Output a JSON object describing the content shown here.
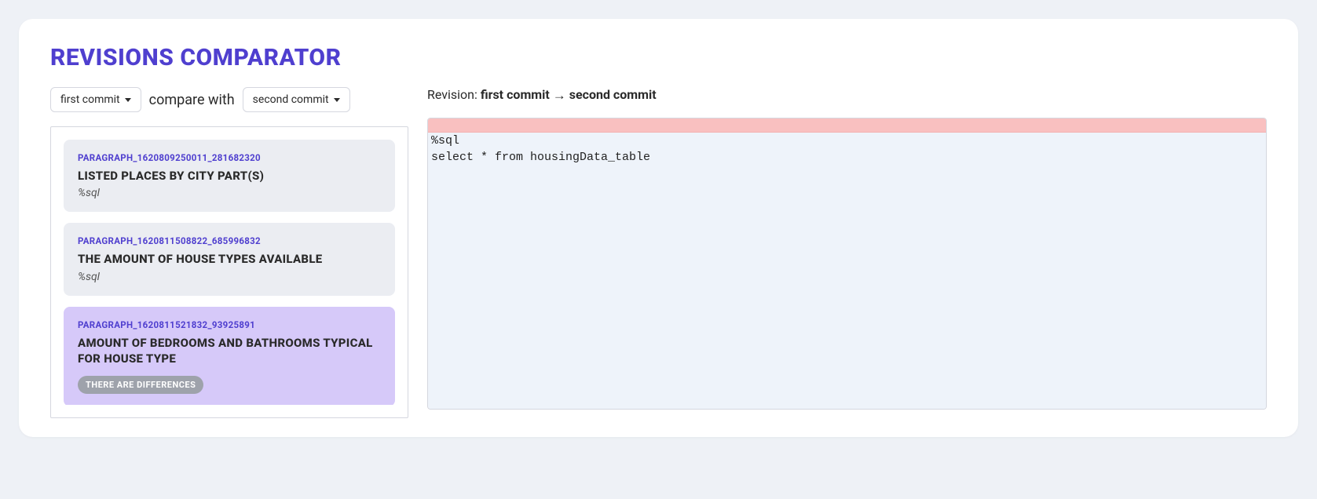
{
  "title": "REVISIONS COMPARATOR",
  "selectors": {
    "first_label": "first commit",
    "compare_with": "compare with",
    "second_label": "second commit"
  },
  "revision": {
    "prefix": "Revision: ",
    "from": "first commit",
    "to": "second commit"
  },
  "code": "%sql\nselect * from housingData_table",
  "paragraphs": [
    {
      "id": "PARAGRAPH_1620809250011_281682320",
      "title": "LISTED PLACES BY CITY PART(S)",
      "lang": "%sql",
      "highlighted": false,
      "diff": false
    },
    {
      "id": "PARAGRAPH_1620811508822_685996832",
      "title": "THE AMOUNT OF HOUSE TYPES AVAILABLE",
      "lang": "%sql",
      "highlighted": false,
      "diff": false
    },
    {
      "id": "PARAGRAPH_1620811521832_93925891",
      "title": "AMOUNT OF BEDROOMS AND BATHROOMS TYPICAL FOR HOUSE TYPE",
      "lang": "",
      "highlighted": true,
      "diff": true,
      "diff_label": "THERE ARE DIFFERENCES"
    }
  ]
}
